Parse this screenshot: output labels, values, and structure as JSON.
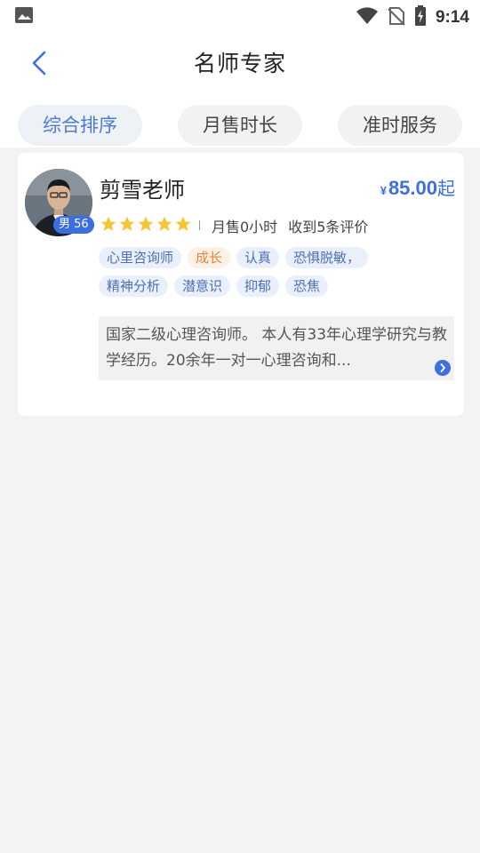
{
  "status_bar": {
    "time": "9:14",
    "icons": [
      "image-icon",
      "wifi-icon",
      "no-sim-icon",
      "battery-charging-icon"
    ]
  },
  "header": {
    "title": "名师专家",
    "back_icon": "chevron-left-icon"
  },
  "sort_tabs": [
    {
      "label": "综合排序",
      "active": true
    },
    {
      "label": "月售时长",
      "active": false
    },
    {
      "label": "准时服务",
      "active": false
    }
  ],
  "teachers": [
    {
      "name": "剪雪老师",
      "gender_age": "男 56",
      "price": {
        "currency": "¥",
        "amount": "85.00",
        "suffix": "起"
      },
      "rating_stars": 5,
      "monthly_sales": "月售0小时",
      "reviews": "收到5条评价",
      "tags": [
        {
          "label": "心里咨询师",
          "style": "blue"
        },
        {
          "label": "成长",
          "style": "orange"
        },
        {
          "label": "认真",
          "style": "blue"
        },
        {
          "label": "恐惧脱敏，",
          "style": "blue"
        },
        {
          "label": "精神分析",
          "style": "blue"
        },
        {
          "label": "潜意识",
          "style": "blue"
        },
        {
          "label": "抑郁",
          "style": "blue"
        },
        {
          "label": "恐焦",
          "style": "blue"
        }
      ],
      "intro": "国家二级心理咨询师。 本人有33年心理学研究与教学经历。20余年一对一心理咨询和..."
    }
  ],
  "colors": {
    "accent": "#3d6fe0",
    "star": "#f7c531",
    "tag_orange": "#e8853c",
    "background": "#f3f3f3"
  }
}
